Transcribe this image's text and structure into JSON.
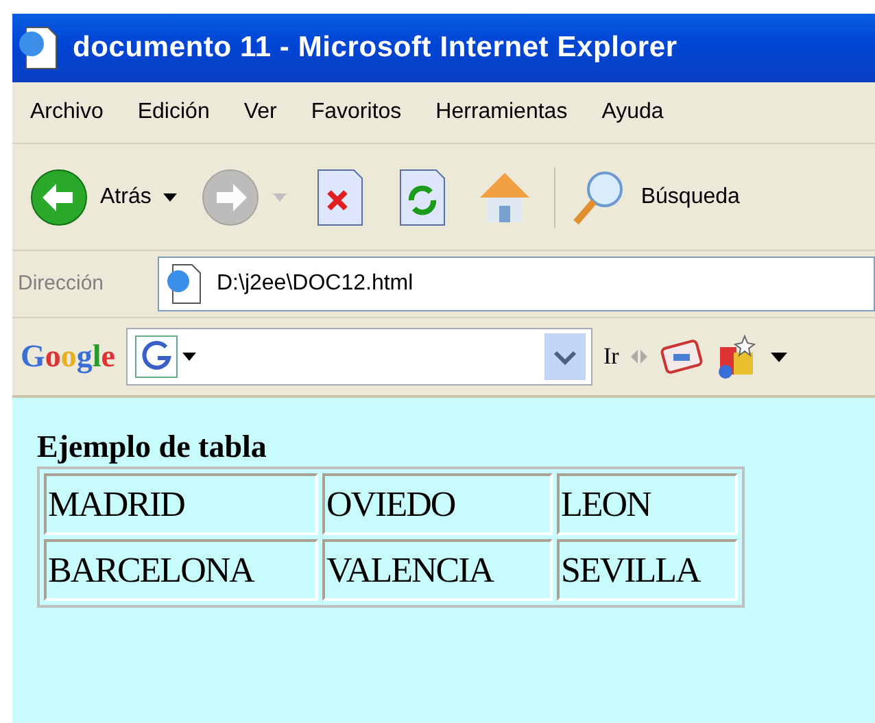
{
  "window": {
    "title": "documento 11 - Microsoft Internet Explorer"
  },
  "menu": [
    "Archivo",
    "Edición",
    "Ver",
    "Favoritos",
    "Herramientas",
    "Ayuda"
  ],
  "toolbar": [
    {
      "kind": "back",
      "label": "Atrás",
      "disabled": false
    },
    {
      "kind": "forward",
      "disabled": true
    },
    {
      "kind": "stop"
    },
    {
      "kind": "refresh"
    },
    {
      "kind": "home"
    },
    {
      "kind": "search",
      "label": "Búsqueda"
    }
  ],
  "address": {
    "label": "Dirección",
    "value": "D:\\j2ee\\DOC12.html"
  },
  "google_bar": {
    "logo": "Google",
    "go": "Ir"
  },
  "page": {
    "heading": "Ejemplo de tabla",
    "table": {
      "rows": [
        [
          "MADRID",
          "OVIEDO",
          "LEON"
        ],
        [
          "BARCELONA",
          "VALENCIA",
          "SEVILLA"
        ]
      ]
    }
  }
}
